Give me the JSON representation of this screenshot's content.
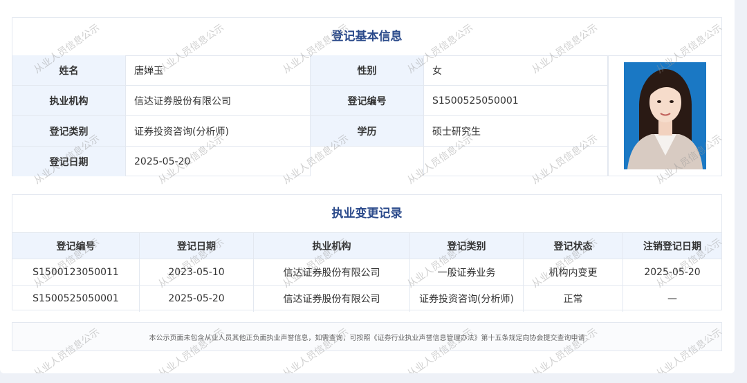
{
  "basic": {
    "title": "登记基本信息",
    "rows": [
      {
        "l1": "姓名",
        "v1": "唐婵玉",
        "l2": "性别",
        "v2": "女"
      },
      {
        "l1": "执业机构",
        "v1": "信达证券股份有限公司",
        "l2": "登记编号",
        "v2": "S1500525050001"
      },
      {
        "l1": "登记类别",
        "v1": "证券投资咨询(分析师)",
        "l2": "学历",
        "v2": "硕士研究生"
      },
      {
        "l1": "登记日期",
        "v1": "2025-05-20",
        "l2": "",
        "v2": ""
      }
    ],
    "photo_bg": "#1a78c4"
  },
  "changes": {
    "title": "执业变更记录",
    "headers": [
      "登记编号",
      "登记日期",
      "执业机构",
      "登记类别",
      "登记状态",
      "注销登记日期"
    ],
    "rows": [
      [
        "S1500123050011",
        "2023-05-10",
        "信达证券股份有限公司",
        "一般证券业务",
        "机构内变更",
        "2025-05-20"
      ],
      [
        "S1500525050001",
        "2025-05-20",
        "信达证券股份有限公司",
        "证券投资咨询(分析师)",
        "正常",
        "—"
      ]
    ]
  },
  "notice": "本公示页面未包含从业人员其他正负面执业声誉信息，如需查询，可按照《证券行业执业声誉信息管理办法》第十五条规定向协会提交查询申请",
  "watermark": "从业人员信息公示",
  "colors": {
    "title": "#2b4a8b",
    "label_bg": "#eef4fd"
  }
}
